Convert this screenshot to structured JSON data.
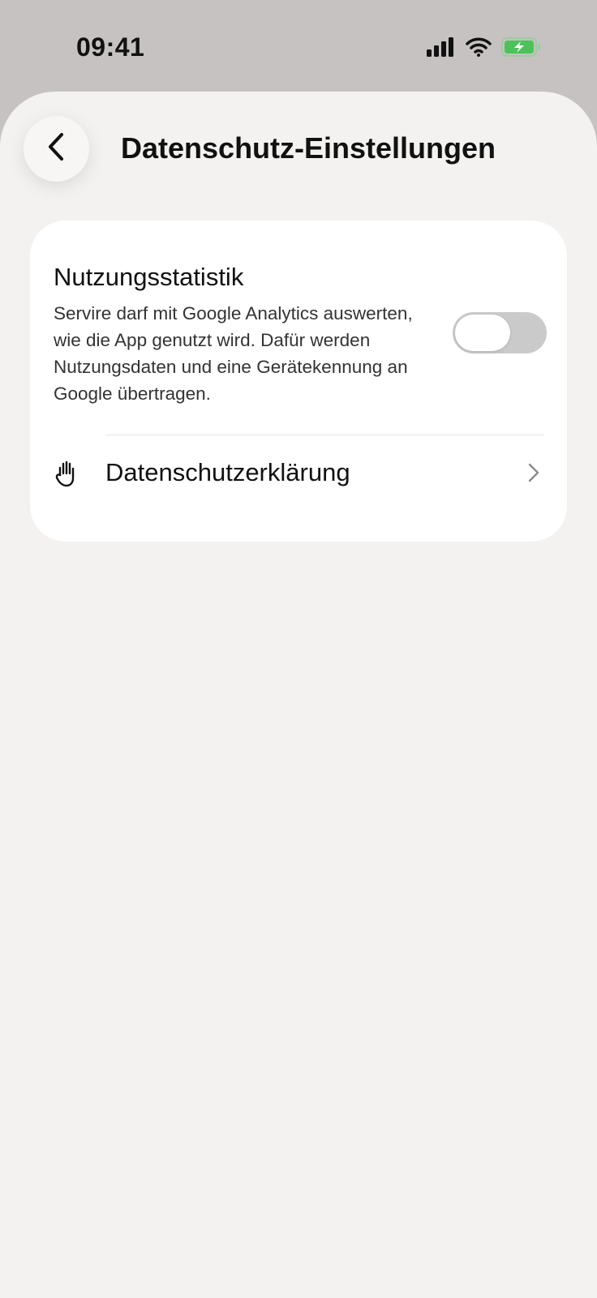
{
  "status_bar": {
    "time": "09:41",
    "icons": [
      "signal-icon",
      "wifi-icon",
      "battery-charging-icon"
    ],
    "battery_color": "#4cc25a"
  },
  "header": {
    "title": "Datenschutz-Einstellungen",
    "back_icon": "chevron-left-icon"
  },
  "settings": {
    "usage_stats": {
      "title": "Nutzungsstatistik",
      "description": "Servire darf mit Google Analytics auswerten, wie die App genutzt wird. Dafür werden Nutzungsdaten und eine Gerätekennung an Google übertragen.",
      "enabled": false
    },
    "privacy_policy": {
      "label": "Datenschutzerklärung",
      "icon": "hand-icon",
      "chevron": "chevron-right-icon"
    }
  },
  "colors": {
    "top_background": "#c6c2c1",
    "sheet_background": "#f3f2f0",
    "card_background": "#ffffff",
    "toggle_off": "#cbcaca"
  }
}
